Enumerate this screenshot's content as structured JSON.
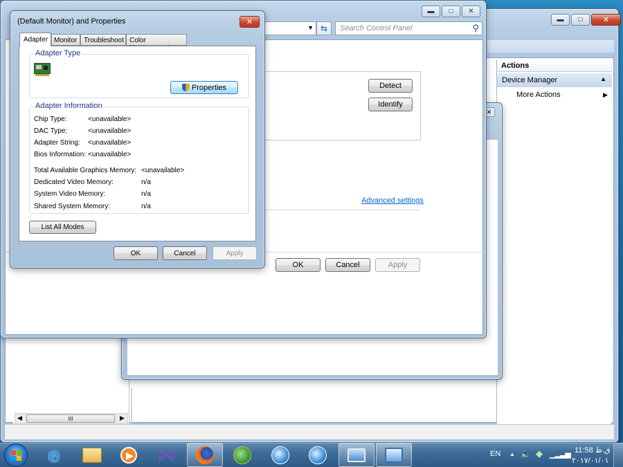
{
  "dialog": {
    "title": "(Default Monitor) and  Properties",
    "tabs": [
      "Adapter",
      "Monitor",
      "Troubleshoot",
      "Color Management"
    ],
    "adapter_type_legend": "Adapter Type",
    "properties_button": "Properties",
    "adapter_info_legend": "Adapter Information",
    "info_rows": [
      {
        "label": "Chip Type:",
        "value": "<unavailable>"
      },
      {
        "label": "DAC Type:",
        "value": "<unavailable>"
      },
      {
        "label": "Adapter String:",
        "value": "<unavailable>"
      },
      {
        "label": "Bios Information:",
        "value": "<unavailable>"
      }
    ],
    "memory_rows": [
      {
        "label": "Total Available Graphics Memory:",
        "value": "<unavailable>"
      },
      {
        "label": "Dedicated Video Memory:",
        "value": "n/a"
      },
      {
        "label": "System Video Memory:",
        "value": "n/a"
      },
      {
        "label": "Shared System Memory:",
        "value": "n/a"
      }
    ],
    "list_all_modes": "List All Modes",
    "ok": "OK",
    "cancel": "Cancel",
    "apply": "Apply"
  },
  "control_panel": {
    "search_placeholder": "Search Control Panel",
    "detect": "Detect",
    "identify": "Identify",
    "advanced_settings": "Advanced settings",
    "ok": "OK",
    "cancel": "Cancel",
    "apply": "Apply"
  },
  "mmc": {
    "actions_header": "Actions",
    "device_manager": "Device Manager",
    "more_actions": "More Actions",
    "scroll_thumb": "III"
  },
  "taskbar": {
    "language": "EN",
    "time": "11:58 ق.ظ",
    "date": "۲۰۱۷/۰۱/۰۱"
  }
}
